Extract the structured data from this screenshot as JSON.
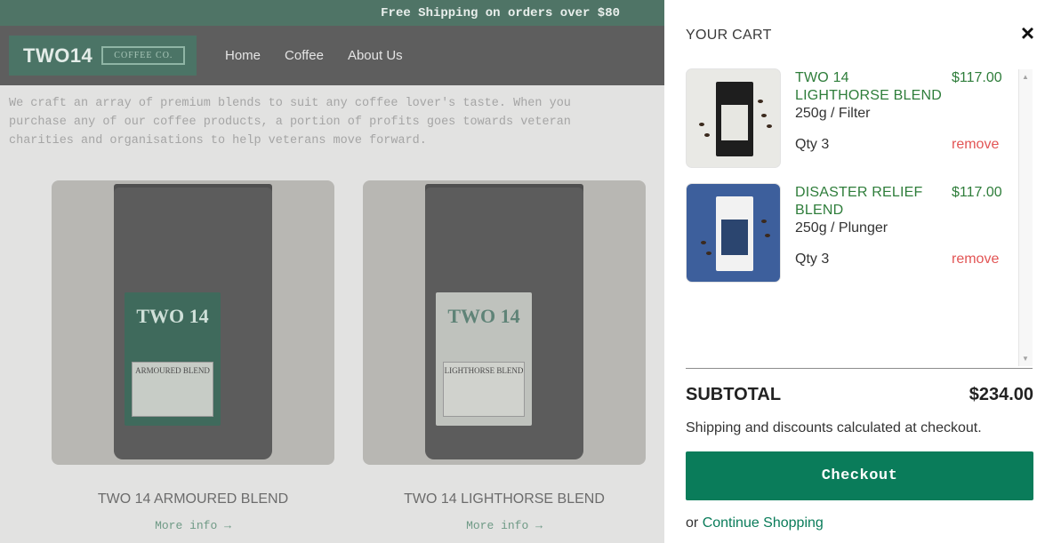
{
  "announcement": "Free Shipping on orders over $80",
  "logo": {
    "name": "TWO14",
    "sub": "COFFEE CO."
  },
  "nav": [
    "Home",
    "Coffee",
    "About Us"
  ],
  "intro": "We craft an array of premium blends to suit any coffee lover's taste. When you purchase any of our coffee products, a portion of profits goes towards veteran charities and organisations to help veterans move forward.",
  "products": [
    {
      "name": "TWO 14 ARMOURED BLEND",
      "label_title": "TWO 14",
      "label_blend": "ARMOURED BLEND",
      "more": "More info →"
    },
    {
      "name": "TWO 14 LIGHTHORSE BLEND",
      "label_title": "TWO 14",
      "label_blend": "LIGHTHORSE BLEND",
      "more": "More info →"
    }
  ],
  "cart": {
    "title": "YOUR CART",
    "close_icon": "×",
    "items": [
      {
        "name": "TWO 14 LIGHTHORSE BLEND",
        "price": "$117.00",
        "variant": "250g / Filter",
        "qty": "Qty 3",
        "remove": "remove"
      },
      {
        "name": "DISASTER RELIEF BLEND",
        "price": "$117.00",
        "variant": "250g / Plunger",
        "qty": "Qty 3",
        "remove": "remove"
      }
    ],
    "subtotal_label": "SUBTOTAL",
    "subtotal_value": "$234.00",
    "shipping_note": "Shipping and discounts calculated at checkout.",
    "checkout_label": "Checkout",
    "continue_prefix": "or",
    "continue_label": "Continue Shopping"
  },
  "colors": {
    "accent_green": "#0a7c5a",
    "item_green": "#2e7d3a",
    "remove_red": "#e25555",
    "announce_bg": "#4f7466"
  }
}
